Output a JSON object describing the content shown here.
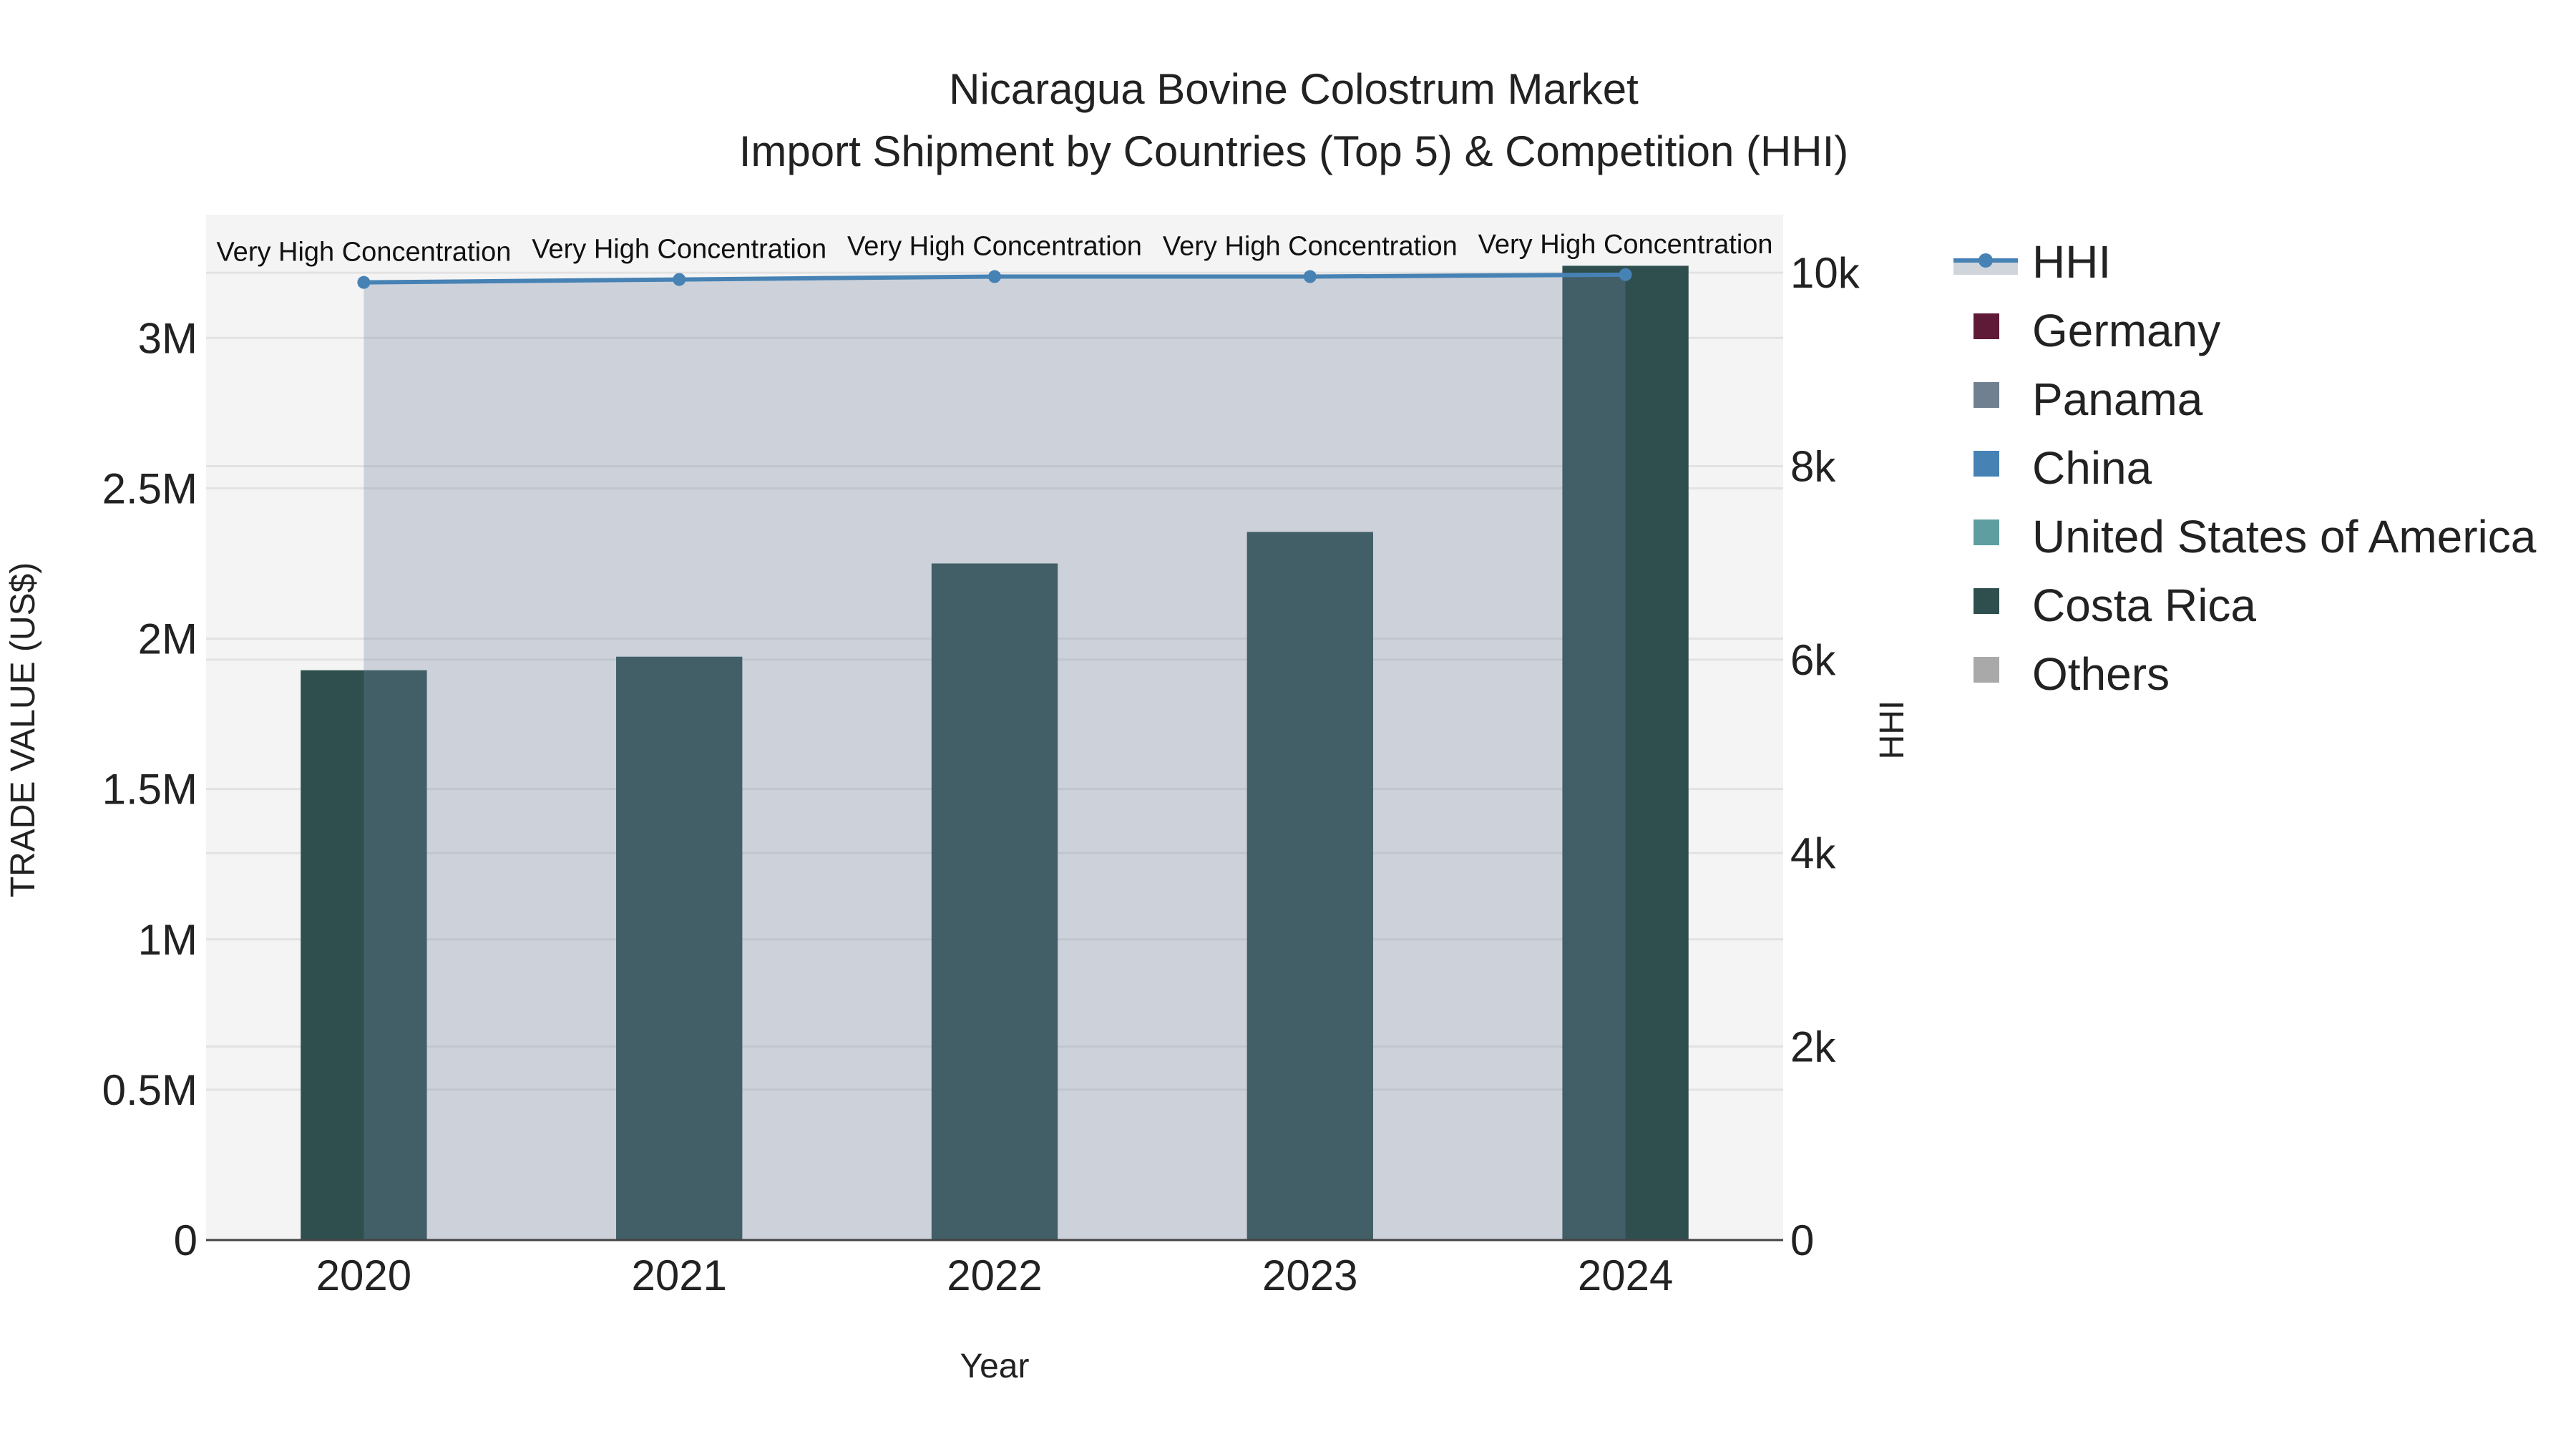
{
  "chart_data": {
    "type": "bar",
    "title_line1": "Nicaragua Bovine Colostrum Market",
    "title_line2": "Import Shipment by Countries (Top 5) & Competition (HHI)",
    "xlabel": "Year",
    "ylabel": "TRADE VALUE (US$)",
    "y2label": "HHI",
    "categories": [
      "2020",
      "2021",
      "2022",
      "2023",
      "2024"
    ],
    "ylim": [
      0,
      3410000
    ],
    "y2lim": [
      0,
      10600
    ],
    "yticks": [
      {
        "v": 0,
        "label": "0"
      },
      {
        "v": 500000,
        "label": "0.5M"
      },
      {
        "v": 1000000,
        "label": "1M"
      },
      {
        "v": 1500000,
        "label": "1.5M"
      },
      {
        "v": 2000000,
        "label": "2M"
      },
      {
        "v": 2500000,
        "label": "2.5M"
      },
      {
        "v": 3000000,
        "label": "3M"
      }
    ],
    "y2ticks": [
      {
        "v": 0,
        "label": "0"
      },
      {
        "v": 2000,
        "label": "2k"
      },
      {
        "v": 4000,
        "label": "4k"
      },
      {
        "v": 6000,
        "label": "6k"
      },
      {
        "v": 8000,
        "label": "8k"
      },
      {
        "v": 10000,
        "label": "10k"
      }
    ],
    "series": [
      {
        "name": "Germany",
        "color": "#5f1a37",
        "values": [
          0,
          0,
          0,
          0,
          0
        ]
      },
      {
        "name": "Panama",
        "color": "#708090",
        "values": [
          0,
          0,
          0,
          0,
          0
        ]
      },
      {
        "name": "China",
        "color": "#4682b4",
        "values": [
          0,
          0,
          0,
          0,
          0
        ]
      },
      {
        "name": "United States of America",
        "color": "#5f9ea0",
        "values": [
          0,
          0,
          0,
          0,
          0
        ]
      },
      {
        "name": "Costa Rica",
        "color": "#2f4f4f",
        "values": [
          1895000,
          1940000,
          2250000,
          2355000,
          3240000
        ]
      },
      {
        "name": "Others",
        "color": "#a9a9a9",
        "values": [
          0,
          0,
          0,
          0,
          0
        ]
      }
    ],
    "hhi": {
      "name": "HHI",
      "color": "#4682b4",
      "values": [
        9900,
        9930,
        9960,
        9960,
        9980
      ],
      "labels": [
        "Very High Concentration",
        "Very High Concentration",
        "Very High Concentration",
        "Very High Concentration",
        "Very High Concentration"
      ]
    },
    "legend_position": "right"
  }
}
